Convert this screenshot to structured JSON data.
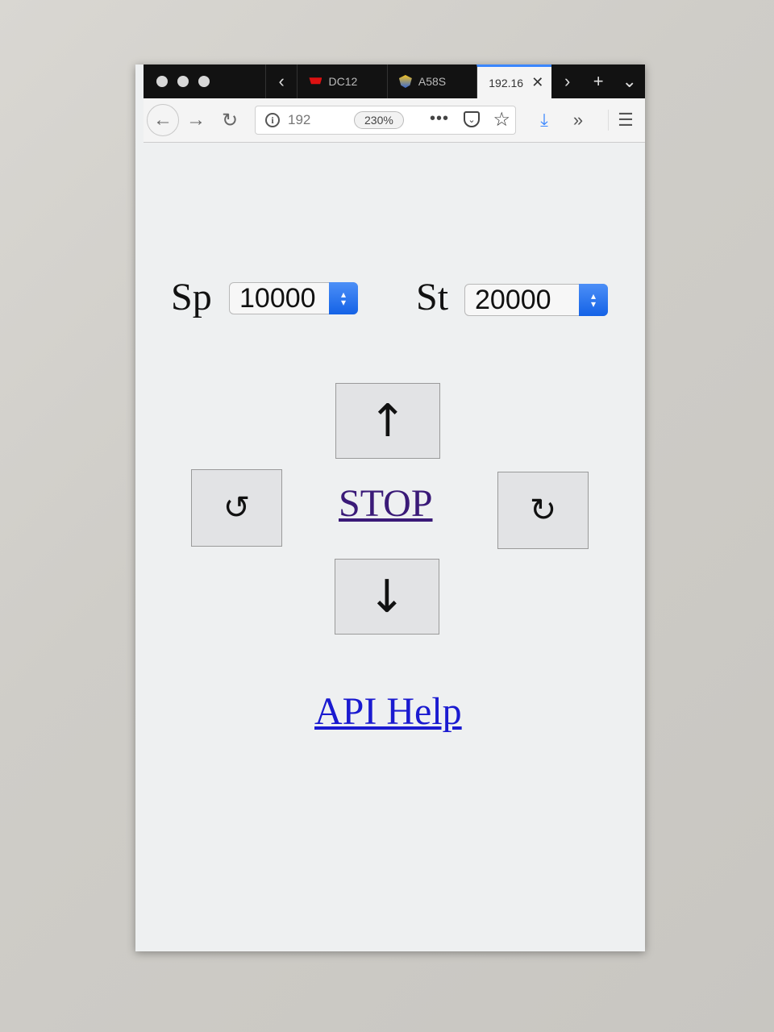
{
  "browser": {
    "tabs": [
      {
        "label": "DC12",
        "icon": "shopping-cart-icon"
      },
      {
        "label": "A58S",
        "icon": "shield-icon"
      },
      {
        "label": "192.16",
        "icon": "close-icon",
        "active": true
      }
    ],
    "url": "192",
    "zoom": "230%",
    "accent_color": "#3a86ff"
  },
  "controls": {
    "sp_label": "Sp",
    "sp_value": "10000",
    "st_label": "St",
    "st_value": "20000",
    "up_glyph": "↑",
    "down_glyph": "↓",
    "rotate_left_glyph": "↺",
    "rotate_right_glyph": "↻",
    "stop_label": "STOP",
    "stop_color": "#3a1a78"
  },
  "footer": {
    "api_help_label": "API Help",
    "link_color": "#1a1ad0"
  }
}
